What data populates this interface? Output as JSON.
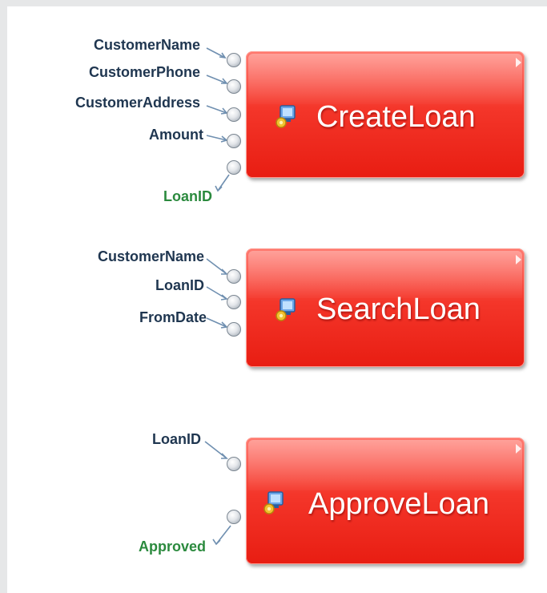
{
  "colors": {
    "block_red": "#f4362a",
    "input_label": "#1f3650",
    "output_label": "#2b8a3e"
  },
  "activities": [
    {
      "title": "CreateLoan",
      "icon": "activity-monitor-gear-icon",
      "inputs": [
        "CustomerName",
        "CustomerPhone",
        "CustomerAddress",
        "Amount"
      ],
      "outputs": [
        "LoanID"
      ]
    },
    {
      "title": "SearchLoan",
      "icon": "activity-monitor-gear-icon",
      "inputs": [
        "CustomerName",
        "LoanID",
        "FromDate"
      ],
      "outputs": []
    },
    {
      "title": "ApproveLoan",
      "icon": "activity-monitor-gear-icon",
      "inputs": [
        "LoanID"
      ],
      "outputs": [
        "Approved"
      ]
    }
  ]
}
